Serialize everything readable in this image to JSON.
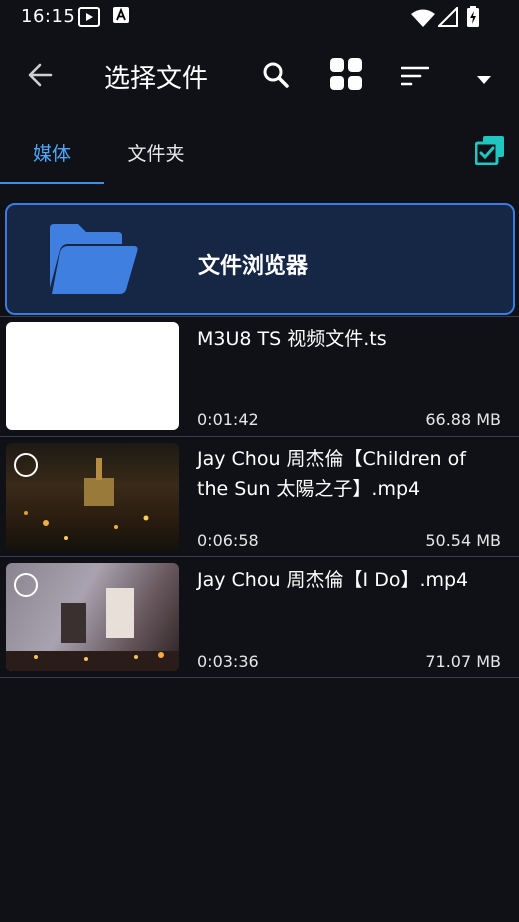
{
  "status": {
    "time": "16:15"
  },
  "appbar": {
    "title": "选择文件"
  },
  "tabs": [
    {
      "label": "媒体"
    },
    {
      "label": "文件夹"
    }
  ],
  "file_browser": {
    "label": "文件浏览器"
  },
  "files": [
    {
      "name": "M3U8 TS 视频文件.ts",
      "duration": "0:01:42",
      "size": "66.88 MB"
    },
    {
      "name": "Jay Chou 周杰倫【Children of the Sun 太陽之子】.mp4",
      "duration": "0:06:58",
      "size": "50.54 MB"
    },
    {
      "name": "Jay Chou 周杰倫【I Do】.mp4",
      "duration": "0:03:36",
      "size": "71.07 MB"
    }
  ],
  "accent_color": "#3e8fe6"
}
